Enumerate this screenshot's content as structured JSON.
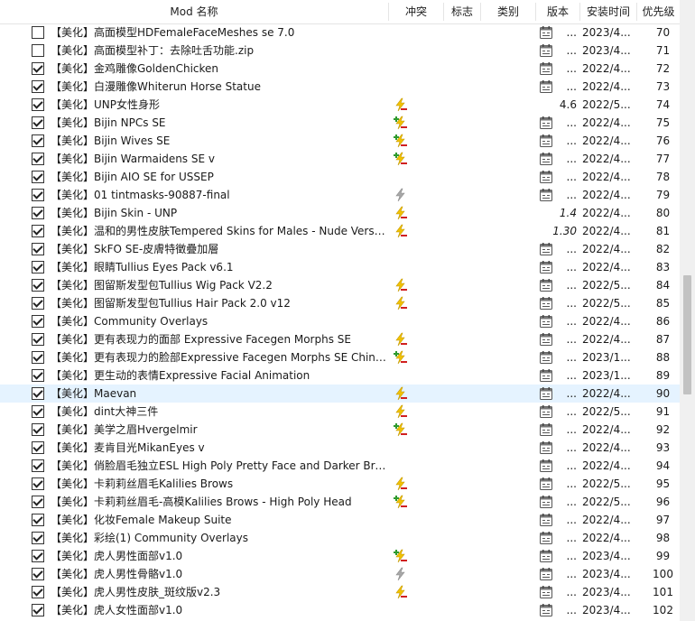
{
  "columns": {
    "name": "Mod 名称",
    "conflict": "冲突",
    "flags": "标志",
    "category": "类别",
    "version": "版本",
    "install_time": "安装时间",
    "priority": "优先级"
  },
  "mods": [
    {
      "checked": false,
      "name": "【美化】高面模型HDFemaleFaceMeshes se 7.0",
      "conflict": null,
      "version_icon": true,
      "version": "...",
      "version_italic": false,
      "install_time": "2023/4...",
      "priority": "70"
    },
    {
      "checked": false,
      "name": "【美化】高面模型补丁：去除吐舌功能.zip",
      "conflict": null,
      "version_icon": true,
      "version": "...",
      "version_italic": false,
      "install_time": "2023/4...",
      "priority": "71"
    },
    {
      "checked": true,
      "name": "【美化】金鸡雕像GoldenChicken",
      "conflict": null,
      "version_icon": true,
      "version": "...",
      "version_italic": false,
      "install_time": "2022/4...",
      "priority": "72"
    },
    {
      "checked": true,
      "name": "【美化】白漫雕像Whiterun Horse Statue",
      "conflict": null,
      "version_icon": true,
      "version": "...",
      "version_italic": false,
      "install_time": "2022/4...",
      "priority": "73"
    },
    {
      "checked": true,
      "name": "【美化】UNP女性身形",
      "conflict": "overwritten",
      "version_icon": false,
      "version": "4.6",
      "version_italic": false,
      "install_time": "2022/5...",
      "priority": "74"
    },
    {
      "checked": true,
      "name": "【美化】Bijin NPCs SE",
      "conflict": "mixed",
      "version_icon": true,
      "version": "...",
      "version_italic": false,
      "install_time": "2022/4...",
      "priority": "75"
    },
    {
      "checked": true,
      "name": "【美化】Bijin Wives SE",
      "conflict": "mixed",
      "version_icon": true,
      "version": "...",
      "version_italic": false,
      "install_time": "2022/4...",
      "priority": "76"
    },
    {
      "checked": true,
      "name": "【美化】Bijin Warmaidens SE v",
      "conflict": "mixed",
      "version_icon": true,
      "version": "...",
      "version_italic": false,
      "install_time": "2022/4...",
      "priority": "77"
    },
    {
      "checked": true,
      "name": "【美化】Bijin AIO SE for USSEP",
      "conflict": null,
      "version_icon": true,
      "version": "...",
      "version_italic": false,
      "install_time": "2022/4...",
      "priority": "78"
    },
    {
      "checked": true,
      "name": "【美化】01 tintmasks-90887-final",
      "conflict": "redundant",
      "version_icon": true,
      "version": "...",
      "version_italic": false,
      "install_time": "2022/4...",
      "priority": "79"
    },
    {
      "checked": true,
      "name": "【美化】Bijin Skin - UNP",
      "conflict": "overwritten",
      "version_icon": false,
      "version": "1.4",
      "version_italic": true,
      "install_time": "2022/4...",
      "priority": "80"
    },
    {
      "checked": true,
      "name": "【美化】温和的男性皮肤Tempered Skins for Males - Nude Versions",
      "conflict": "overwritten",
      "version_icon": false,
      "version": "1.30",
      "version_italic": true,
      "install_time": "2022/4...",
      "priority": "81"
    },
    {
      "checked": true,
      "name": "【美化】SkFO SE-皮膚特徵疊加層",
      "conflict": null,
      "version_icon": true,
      "version": "...",
      "version_italic": false,
      "install_time": "2022/4...",
      "priority": "82"
    },
    {
      "checked": true,
      "name": "【美化】眼睛Tullius Eyes Pack v6.1",
      "conflict": null,
      "version_icon": true,
      "version": "...",
      "version_italic": false,
      "install_time": "2022/4...",
      "priority": "83"
    },
    {
      "checked": true,
      "name": "【美化】图留斯发型包Tullius Wig Pack V2.2",
      "conflict": "overwritten",
      "version_icon": true,
      "version": "...",
      "version_italic": false,
      "install_time": "2022/5...",
      "priority": "84"
    },
    {
      "checked": true,
      "name": "【美化】图留斯发型包Tullius Hair Pack 2.0 v12",
      "conflict": "overwritten",
      "version_icon": true,
      "version": "...",
      "version_italic": false,
      "install_time": "2022/5...",
      "priority": "85"
    },
    {
      "checked": true,
      "name": "【美化】Community Overlays",
      "conflict": null,
      "version_icon": true,
      "version": "...",
      "version_italic": false,
      "install_time": "2022/4...",
      "priority": "86"
    },
    {
      "checked": true,
      "name": "【美化】更有表现力的面部 Expressive Facegen Morphs SE",
      "conflict": "overwritten",
      "version_icon": true,
      "version": "...",
      "version_italic": false,
      "install_time": "2022/4...",
      "priority": "87"
    },
    {
      "checked": true,
      "name": "【美化】更有表现力的脸部Expressive Facegen Morphs SE Chinese",
      "conflict": "mixed",
      "version_icon": true,
      "version": "...",
      "version_italic": false,
      "install_time": "2023/1...",
      "priority": "88"
    },
    {
      "checked": true,
      "name": "【美化】更生动的表情Expressive Facial Animation",
      "conflict": null,
      "version_icon": true,
      "version": "...",
      "version_italic": false,
      "install_time": "2023/1...",
      "priority": "89"
    },
    {
      "checked": true,
      "name": "【美化】Maevan",
      "conflict": "overwritten",
      "version_icon": true,
      "version": "...",
      "version_italic": false,
      "install_time": "2022/4...",
      "priority": "90",
      "highlighted": true
    },
    {
      "checked": true,
      "name": "【美化】dint大神三件",
      "conflict": "overwritten",
      "version_icon": true,
      "version": "...",
      "version_italic": false,
      "install_time": "2022/5...",
      "priority": "91"
    },
    {
      "checked": true,
      "name": "【美化】美学之眉Hvergelmir",
      "conflict": "mixed",
      "version_icon": true,
      "version": "...",
      "version_italic": false,
      "install_time": "2022/4...",
      "priority": "92"
    },
    {
      "checked": true,
      "name": "【美化】麦肯目光MikanEyes v",
      "conflict": null,
      "version_icon": true,
      "version": "...",
      "version_italic": false,
      "install_time": "2022/4...",
      "priority": "93"
    },
    {
      "checked": true,
      "name": "【美化】俏脸眉毛独立ESL High Poly Pretty Face and Darker Brows",
      "conflict": null,
      "version_icon": true,
      "version": "...",
      "version_italic": false,
      "install_time": "2022/4...",
      "priority": "94"
    },
    {
      "checked": true,
      "name": "【美化】卡莉莉丝眉毛Kalilies Brows",
      "conflict": "overwritten",
      "version_icon": true,
      "version": "...",
      "version_italic": false,
      "install_time": "2022/5...",
      "priority": "95"
    },
    {
      "checked": true,
      "name": "【美化】卡莉莉丝眉毛-高模Kalilies Brows - High Poly Head",
      "conflict": "mixed",
      "version_icon": true,
      "version": "...",
      "version_italic": false,
      "install_time": "2022/5...",
      "priority": "96"
    },
    {
      "checked": true,
      "name": "【美化】化妆Female Makeup Suite",
      "conflict": null,
      "version_icon": true,
      "version": "...",
      "version_italic": false,
      "install_time": "2022/4...",
      "priority": "97"
    },
    {
      "checked": true,
      "name": "【美化】彩绘(1) Community Overlays",
      "conflict": null,
      "version_icon": true,
      "version": "...",
      "version_italic": false,
      "install_time": "2022/4...",
      "priority": "98"
    },
    {
      "checked": true,
      "name": "【美化】虎人男性面部v1.0",
      "conflict": "mixed",
      "version_icon": true,
      "version": "...",
      "version_italic": false,
      "install_time": "2023/4...",
      "priority": "99"
    },
    {
      "checked": true,
      "name": "【美化】虎人男性骨骼v1.0",
      "conflict": "redundant",
      "version_icon": true,
      "version": "...",
      "version_italic": false,
      "install_time": "2023/4...",
      "priority": "100"
    },
    {
      "checked": true,
      "name": "【美化】虎人男性皮肤_斑纹版v2.3",
      "conflict": "overwritten",
      "version_icon": true,
      "version": "...",
      "version_italic": false,
      "install_time": "2023/4...",
      "priority": "101"
    },
    {
      "checked": true,
      "name": "【美化】虎人女性面部v1.0",
      "conflict": null,
      "version_icon": true,
      "version": "...",
      "version_italic": false,
      "install_time": "2023/4...",
      "priority": "102"
    }
  ],
  "icons": {
    "overwritten": "lightning-minus-icon",
    "mixed": "lightning-plus-minus-icon",
    "redundant": "lightning-gray-icon",
    "version": "calendar-icon"
  },
  "colors": {
    "highlight_row": "#e5f3ff",
    "lightning_yellow": "#f2c200",
    "conflict_red": "#d02020",
    "conflict_green": "#2e9a2e"
  }
}
